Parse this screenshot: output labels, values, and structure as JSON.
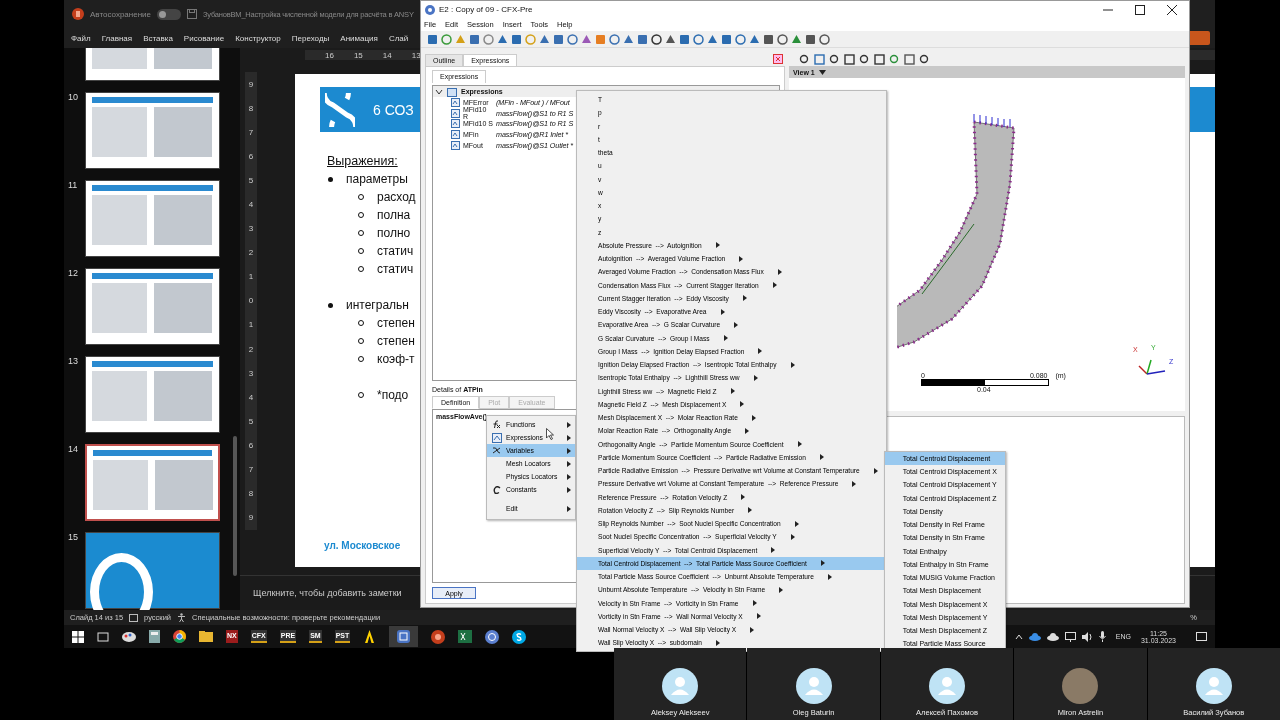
{
  "powerpoint": {
    "autosave": {
      "label": "Автосохранение",
      "on": false
    },
    "title": "ЗубановВМ_Настройка численной модели для расчёта в ANSY",
    "ribbon_tabs": [
      "Файл",
      "Главная",
      "Вставка",
      "Рисование",
      "Конструктор",
      "Переходы",
      "Анимация",
      "Слай"
    ],
    "thumbnails": [
      {
        "kind": "content",
        "selected": false
      },
      {
        "number": "10",
        "kind": "content",
        "selected": false
      },
      {
        "number": "11",
        "kind": "content",
        "selected": false
      },
      {
        "number": "12",
        "kind": "content",
        "selected": false
      },
      {
        "number": "13",
        "kind": "content",
        "selected": false
      },
      {
        "number": "14",
        "kind": "content",
        "selected": true
      },
      {
        "number": "15",
        "kind": "closing",
        "selected": false
      }
    ],
    "ruler_horizontal": [
      "16",
      "15",
      "14",
      "13"
    ],
    "ruler_vertical": [
      "9",
      "8",
      "7",
      "6",
      "5",
      "4",
      "3",
      "2",
      "1",
      "0",
      "1",
      "2",
      "3",
      "4",
      "5",
      "6",
      "7",
      "8",
      "9"
    ],
    "slide": {
      "title": "6 СОЗ",
      "heading": "Выражения:",
      "bullets": [
        {
          "text": "параметры",
          "children": [
            {
              "text": "расход",
              "spaced": false
            },
            {
              "text": "полна",
              "spaced": false
            },
            {
              "text": "полно",
              "spaced": false
            },
            {
              "text": "статич",
              "spaced": false
            },
            {
              "text": "статич",
              "spaced": false
            }
          ]
        },
        {
          "text": "интегральн",
          "children": [
            {
              "text": "степен",
              "spaced": false
            },
            {
              "text": "степен",
              "spaced": false
            },
            {
              "text": "коэф-т",
              "spaced": false
            },
            {
              "text": "*подо",
              "spaced": true
            }
          ]
        }
      ],
      "footer": "ул. Московское"
    },
    "notes_placeholder": "Щелкните, чтобы добавить заметки",
    "status_bar": {
      "slide_counter": "Слайд 14 из 15",
      "language": "русский",
      "accessibility": "Специальные возможности: проверьте рекомендации",
      "zoom": "%"
    }
  },
  "taskbar": {
    "pinned": [
      "NX",
      "CFX",
      "PRE",
      "SM",
      "PST"
    ],
    "language": "ENG",
    "time": "11:25",
    "date": "31.03.2023"
  },
  "cfx": {
    "title": "E2 : Copy of 09 - CFX-Pre",
    "menu": [
      "File",
      "Edit",
      "Session",
      "Insert",
      "Tools",
      "Help"
    ],
    "panel_tabs": [
      {
        "label": "Outline",
        "selected": false
      },
      {
        "label": "Expressions",
        "selected": true
      }
    ],
    "sub_tabs": [
      {
        "label": "Expressions",
        "selected": true
      }
    ],
    "tree": {
      "label": "Expressions",
      "expanded": true,
      "children": [
        {
          "name": "MFError",
          "value": "(MFin - MFout ) / MFout"
        },
        {
          "name": "MFid10 R",
          "value": "massFlow()@S1 to R1 S"
        },
        {
          "name": "MFid10 S",
          "value": "massFlow()@S1 to R1 S"
        },
        {
          "name": "MFin",
          "value": "massFlow()@R1 Inlet *"
        },
        {
          "name": "MFout",
          "value": "massFlow()@S1 Outlet *"
        }
      ]
    },
    "details": {
      "title": "Details of **ATPin**",
      "tabs": [
        {
          "label": "Definition",
          "selected": true,
          "disabled": false
        },
        {
          "label": "Plot",
          "selected": false,
          "disabled": true
        },
        {
          "label": "Evaluate",
          "selected": false,
          "disabled": true
        }
      ],
      "definition": "massFlowAve()",
      "apply": "Apply"
    },
    "view": {
      "label": "View 1",
      "scale": {
        "min": "0",
        "max": "0.080",
        "unit": "(m)",
        "mid": "0.04"
      },
      "axes": [
        "X",
        "Y",
        "Z"
      ]
    }
  },
  "context_menu": [
    {
      "label": "Functions",
      "submenu": true,
      "selected": false,
      "separated": false
    },
    {
      "label": "Expressions",
      "submenu": true,
      "selected": false,
      "separated": false
    },
    {
      "label": "Variables",
      "submenu": true,
      "selected": true,
      "separated": false
    },
    {
      "label": "Mesh Locators",
      "submenu": true,
      "selected": false,
      "separated": false
    },
    {
      "label": "Physics Locators",
      "submenu": true,
      "selected": false,
      "separated": false
    },
    {
      "label": "Constants",
      "submenu": true,
      "selected": false,
      "separated": false
    },
    {
      "label": "Edit",
      "submenu": true,
      "selected": false,
      "separated": true
    }
  ],
  "variables_menu": [
    {
      "label": "T",
      "submenu": false,
      "selected": false
    },
    {
      "label": "p",
      "submenu": false,
      "selected": false
    },
    {
      "label": "r",
      "submenu": false,
      "selected": false
    },
    {
      "label": "t",
      "submenu": false,
      "selected": false
    },
    {
      "label": "theta",
      "submenu": false,
      "selected": false
    },
    {
      "label": "u",
      "submenu": false,
      "selected": false
    },
    {
      "label": "v",
      "submenu": false,
      "selected": false
    },
    {
      "label": "w",
      "submenu": false,
      "selected": false
    },
    {
      "label": "x",
      "submenu": false,
      "selected": false
    },
    {
      "label": "y",
      "submenu": false,
      "selected": false
    },
    {
      "label": "z",
      "submenu": false,
      "selected": false
    },
    {
      "label": "Absolute Pressure  -->  Autoignition",
      "submenu": true,
      "selected": false
    },
    {
      "label": "Autoignition  -->  Averaged Volume Fraction",
      "submenu": true,
      "selected": false
    },
    {
      "label": "Averaged Volume Fraction  -->  Condensation Mass Flux",
      "submenu": true,
      "selected": false
    },
    {
      "label": "Condensation Mass Flux  -->  Current Stagger Iteration",
      "submenu": true,
      "selected": false
    },
    {
      "label": "Current Stagger Iteration  -->  Eddy Viscosity",
      "submenu": true,
      "selected": false
    },
    {
      "label": "Eddy Viscosity  -->  Evaporative Area",
      "submenu": true,
      "selected": false
    },
    {
      "label": "Evaporative Area  -->  G Scalar Curvature",
      "submenu": true,
      "selected": false
    },
    {
      "label": "G Scalar Curvature  -->  Group I Mass",
      "submenu": true,
      "selected": false
    },
    {
      "label": "Group I Mass  -->  Ignition Delay Elapsed Fraction",
      "submenu": true,
      "selected": false
    },
    {
      "label": "Ignition Delay Elapsed Fraction  -->  Isentropic Total Enthalpy",
      "submenu": true,
      "selected": false
    },
    {
      "label": "Isentropic Total Enthalpy  -->  Lighthill Stress ww",
      "submenu": true,
      "selected": false
    },
    {
      "label": "Lighthill Stress ww  -->  Magnetic Field Z",
      "submenu": true,
      "selected": false
    },
    {
      "label": "Magnetic Field Z  -->  Mesh Displacement X",
      "submenu": true,
      "selected": false
    },
    {
      "label": "Mesh Displacement X  -->  Molar Reaction Rate",
      "submenu": true,
      "selected": false
    },
    {
      "label": "Molar Reaction Rate  -->  Orthogonality Angle",
      "submenu": true,
      "selected": false
    },
    {
      "label": "Orthogonality Angle  -->  Particle Momentum Source Coefficient",
      "submenu": true,
      "selected": false
    },
    {
      "label": "Particle Momentum Source Coefficient  -->  Particle Radiative Emission",
      "submenu": true,
      "selected": false
    },
    {
      "label": "Particle Radiative Emission  -->  Pressure Derivative wrt Volume at Constant Temperature",
      "submenu": true,
      "selected": false
    },
    {
      "label": "Pressure Derivative wrt Volume at Constant Temperature  -->  Reference Pressure",
      "submenu": true,
      "selected": false
    },
    {
      "label": "Reference Pressure  -->  Rotation Velocity Z",
      "submenu": true,
      "selected": false
    },
    {
      "label": "Rotation Velocity Z  -->  Slip Reynolds Number",
      "submenu": true,
      "selected": false
    },
    {
      "label": "Slip Reynolds Number  -->  Soot Nuclei Specific Concentration",
      "submenu": true,
      "selected": false
    },
    {
      "label": "Soot Nuclei Specific Concentration  -->  Superficial Velocity Y",
      "submenu": true,
      "selected": false
    },
    {
      "label": "Superficial Velocity Y  -->  Total Centroid Displacement",
      "submenu": true,
      "selected": false
    },
    {
      "label": "Total Centroid Displacement  -->  Total Particle Mass Source Coefficient",
      "submenu": true,
      "selected": true
    },
    {
      "label": "Total Particle Mass Source Coefficient  -->  Unburnt Absolute Temperature",
      "submenu": true,
      "selected": false
    },
    {
      "label": "Unburnt Absolute Temperature  -->  Velocity in Stn Frame",
      "submenu": true,
      "selected": false
    },
    {
      "label": "Velocity in Stn Frame  -->  Vorticity in Stn Frame",
      "submenu": true,
      "selected": false
    },
    {
      "label": "Vorticity in Stn Frame  -->  Wall Normal Velocity X",
      "submenu": true,
      "selected": false
    },
    {
      "label": "Wall Normal Velocity X  -->  Wall Slip Velocity X",
      "submenu": true,
      "selected": false
    },
    {
      "label": "Wall Slip Velocity X  -->  subdomain",
      "submenu": true,
      "selected": false
    }
  ],
  "variable_submenu": [
    {
      "label": "Total Centroid Displacement",
      "selected": true
    },
    {
      "label": "Total Centroid Displacement X",
      "selected": false
    },
    {
      "label": "Total Centroid Displacement Y",
      "selected": false
    },
    {
      "label": "Total Centroid Displacement Z",
      "selected": false
    },
    {
      "label": "Total Density",
      "selected": false
    },
    {
      "label": "Total Density in Rel Frame",
      "selected": false
    },
    {
      "label": "Total Density in Stn Frame",
      "selected": false
    },
    {
      "label": "Total Enthalpy",
      "selected": false
    },
    {
      "label": "Total Enthalpy in Stn Frame",
      "selected": false
    },
    {
      "label": "Total MUSIG Volume Fraction",
      "selected": false
    },
    {
      "label": "Total Mesh Displacement",
      "selected": false
    },
    {
      "label": "Total Mesh Displacement X",
      "selected": false
    },
    {
      "label": "Total Mesh Displacement Y",
      "selected": false
    },
    {
      "label": "Total Mesh Displacement Z",
      "selected": false
    },
    {
      "label": "Total Particle Mass Source",
      "selected": false
    }
  ],
  "participants": [
    {
      "name": "Aleksey Alekseev",
      "photo": false
    },
    {
      "name": "Oleg Baturin",
      "photo": false
    },
    {
      "name": "Алексей Пахомов",
      "photo": false
    },
    {
      "name": "Miron Astrelin",
      "photo": true
    },
    {
      "name": "Василий Зубанов",
      "photo": false
    }
  ]
}
